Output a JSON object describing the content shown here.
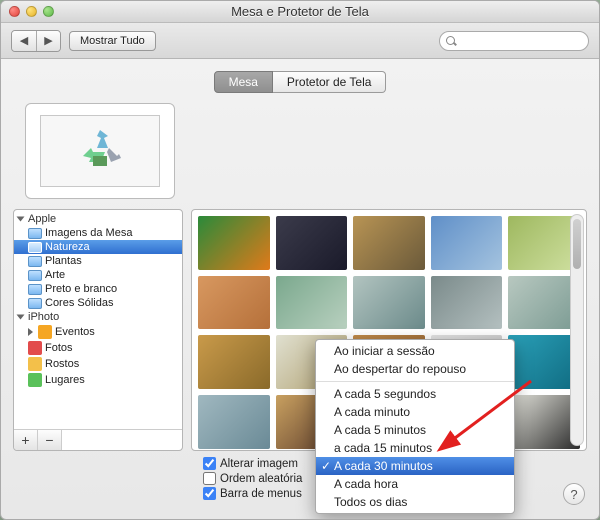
{
  "window": {
    "title": "Mesa e Protetor de Tela"
  },
  "toolbar": {
    "back_label": "◀",
    "forward_label": "▶",
    "show_all_label": "Mostrar Tudo",
    "search_placeholder": ""
  },
  "tabs": [
    {
      "label": "Mesa",
      "active": true
    },
    {
      "label": "Protetor de Tela",
      "active": false
    }
  ],
  "sidebar": {
    "groups": [
      {
        "label": "Apple",
        "items": [
          {
            "label": "Imagens da Mesa",
            "icon": "folder",
            "selected": false
          },
          {
            "label": "Natureza",
            "icon": "folder",
            "selected": true
          },
          {
            "label": "Plantas",
            "icon": "folder",
            "selected": false
          },
          {
            "label": "Arte",
            "icon": "folder",
            "selected": false
          },
          {
            "label": "Preto e branco",
            "icon": "folder",
            "selected": false
          },
          {
            "label": "Cores Sólidas",
            "icon": "folder",
            "selected": false
          }
        ]
      },
      {
        "label": "iPhoto",
        "items": [
          {
            "label": "Eventos",
            "icon": "events",
            "selected": false,
            "expandable": true
          },
          {
            "label": "Fotos",
            "icon": "photos",
            "selected": false
          },
          {
            "label": "Rostos",
            "icon": "faces",
            "selected": false
          },
          {
            "label": "Lugares",
            "icon": "places",
            "selected": false
          }
        ]
      }
    ],
    "add_label": "+",
    "remove_label": "−"
  },
  "thumbnails": [
    {
      "color1": "#2a8a3a",
      "color2": "#e07a1a"
    },
    {
      "color1": "#3b3b4b",
      "color2": "#1a1a2a"
    },
    {
      "color1": "#b89454",
      "color2": "#6b5a3a"
    },
    {
      "color1": "#5f8fc8",
      "color2": "#a4c3df"
    },
    {
      "color1": "#9eb85f",
      "color2": "#cfe0a0"
    },
    {
      "color1": "#d89860",
      "color2": "#b5703a"
    },
    {
      "color1": "#7aa88d",
      "color2": "#b8d0bf"
    },
    {
      "color1": "#b2c4c0",
      "color2": "#6b8a8a"
    },
    {
      "color1": "#7a8a8a",
      "color2": "#b4c0c0"
    },
    {
      "color1": "#b8c8c0",
      "color2": "#7a9a92"
    },
    {
      "color1": "#c99a4a",
      "color2": "#8a6a2a"
    },
    {
      "color1": "#e0e0d0",
      "color2": "#b0a070"
    },
    {
      "color1": "#c08a4a",
      "color2": "#8f6030"
    },
    {
      "color1": "#e2e2e2",
      "color2": "#c0c0c0"
    },
    {
      "color1": "#2aa0b8",
      "color2": "#0f6a80"
    },
    {
      "color1": "#a0b8c0",
      "color2": "#6a8a96"
    },
    {
      "color1": "#c8a060",
      "color2": "#5a3a2a"
    },
    {
      "color1": "#e0e8f0",
      "color2": "#b0c0d0"
    },
    {
      "color1": "#7a5a3a",
      "color2": "#3a2a1a"
    },
    {
      "color1": "#e8e8e0",
      "color2": "#2a2a2a"
    }
  ],
  "options": {
    "change_picture_label": "Alterar imagem",
    "change_picture_checked": true,
    "random_order_label": "Ordem aleatória",
    "random_order_checked": false,
    "menu_bar_label": "Barra de menus",
    "menu_bar_checked": true
  },
  "interval_menu": {
    "items": [
      "Ao iniciar a sessão",
      "Ao despertar do repouso",
      "A cada 5 segundos",
      "A cada minuto",
      "A cada 5 minutos",
      "a cada 15 minutos",
      "A cada 30 minutos",
      "A cada hora",
      "Todos os dias"
    ],
    "separator_after_index": 1,
    "selected_index": 6
  },
  "help_label": "?"
}
